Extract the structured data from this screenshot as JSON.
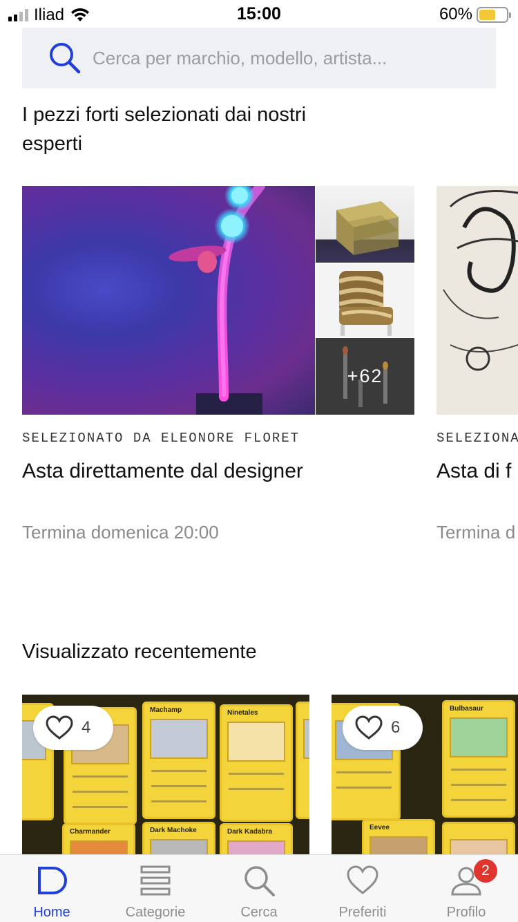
{
  "status_bar": {
    "carrier": "Iliad",
    "time": "15:00",
    "battery_percent": "60%",
    "battery_level": 0.6,
    "icons": [
      "signal-icon",
      "wifi-icon",
      "battery-icon"
    ]
  },
  "search": {
    "placeholder": "Cerca per marchio, modello, artista...",
    "icon": "search-icon",
    "accent_color": "#1f3fd6"
  },
  "featured": {
    "title": "I pezzi forti selezionati dai nostri esperti",
    "cards": [
      {
        "curator": "SELEZIONATO DA ELEONORE FLORET",
        "title": "Asta direttamente dal designer",
        "ends": "Termina domenica 20:00",
        "more_count": "+62"
      },
      {
        "curator": "SELEZIONA",
        "title": "Asta di f",
        "ends": "Termina d"
      }
    ]
  },
  "recent": {
    "title": "Visualizzato recentemente",
    "items": [
      {
        "likes": "4",
        "cards": [
          "Machamp",
          "Ninetales",
          "Charmander",
          "Dark Machoke",
          "Dark Kadabra"
        ]
      },
      {
        "likes": "6",
        "cards": [
          "Bulbasaur",
          "Eevee"
        ]
      }
    ]
  },
  "tab_bar": {
    "tabs": [
      {
        "label": "Home",
        "icon": "home-icon",
        "active": true
      },
      {
        "label": "Categorie",
        "icon": "categories-icon",
        "active": false
      },
      {
        "label": "Cerca",
        "icon": "search-icon",
        "active": false
      },
      {
        "label": "Preferiti",
        "icon": "heart-icon",
        "active": false
      },
      {
        "label": "Profilo",
        "icon": "profile-icon",
        "active": false,
        "badge": "2"
      }
    ],
    "active_color": "#1f3fd6",
    "badge_color": "#e0342f"
  }
}
